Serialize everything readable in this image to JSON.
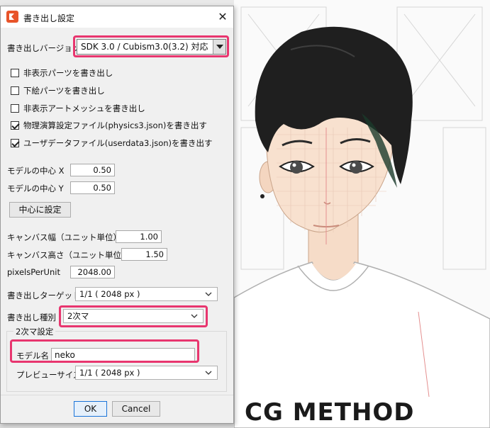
{
  "dialog": {
    "title": "書き出し設定",
    "close_symbol": "✕",
    "version_label": "書き出しバージョン",
    "version_value": "SDK 3.0 / Cubism3.0(3.2) 対応",
    "checkboxes": [
      {
        "label": "非表示パーツを書き出し",
        "checked": false
      },
      {
        "label": "下絵パーツを書き出し",
        "checked": false
      },
      {
        "label": "非表示アートメッシュを書き出し",
        "checked": false
      },
      {
        "label": "物理演算設定ファイル(physics3.json)を書き出す",
        "checked": true
      },
      {
        "label": "ユーザデータファイル(userdata3.json)を書き出す",
        "checked": true
      }
    ],
    "center_x_label": "モデルの中心 X",
    "center_x_value": "0.50",
    "center_y_label": "モデルの中心 Y",
    "center_y_value": "0.50",
    "set_center_button": "中心に設定",
    "canvas_width_label": "キャンバス幅（ユニット単位）",
    "canvas_width_value": "1.00",
    "canvas_height_label": "キャンバス高さ（ユニット単位）",
    "canvas_height_value": "1.50",
    "ppu_label": "pixelsPerUnit",
    "ppu_value": "2048.00",
    "target_label": "書き出しターゲット",
    "target_value": "1/1 ( 2048 px )",
    "type_label": "書き出し種別",
    "type_value": "2次マ",
    "group_title": "2次マ設定",
    "model_name_label": "モデル名",
    "model_name_value": "neko",
    "preview_size_label": "プレビューサイズ",
    "preview_size_value": "1/1 ( 2048 px )",
    "ok_button": "OK",
    "cancel_button": "Cancel"
  },
  "canvas": {
    "watermark": "CG METHOD",
    "highlight_color": "#e8366f",
    "app_icon_color": "#e8542a"
  }
}
